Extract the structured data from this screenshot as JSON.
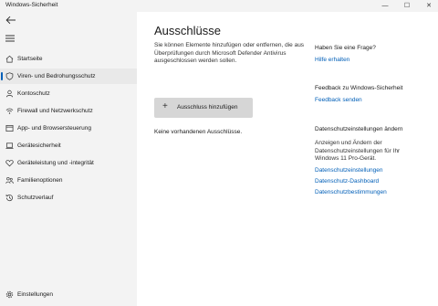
{
  "window": {
    "title": "Windows-Sicherheit",
    "minimize_glyph": "—",
    "maximize_glyph": "☐",
    "close_glyph": "✕"
  },
  "sidebar": {
    "items": [
      {
        "label": "Startseite",
        "icon": "home-icon"
      },
      {
        "label": "Viren- und Bedrohungsschutz",
        "icon": "shield-icon",
        "active": true
      },
      {
        "label": "Kontoschutz",
        "icon": "person-icon"
      },
      {
        "label": "Firewall und Netzwerkschutz",
        "icon": "wifi-icon"
      },
      {
        "label": "App- und Browsersteuerung",
        "icon": "app-window-icon"
      },
      {
        "label": "Gerätesicherheit",
        "icon": "laptop-icon"
      },
      {
        "label": "Geräteleistung und -integrität",
        "icon": "heart-icon"
      },
      {
        "label": "Familienoptionen",
        "icon": "family-icon"
      },
      {
        "label": "Schutzverlauf",
        "icon": "history-icon"
      }
    ],
    "settings_label": "Einstellungen"
  },
  "main": {
    "title": "Ausschlüsse",
    "description": "Sie können Elemente hinzufügen oder entfernen, die aus Überprüfungen durch Microsoft Defender Antivirus ausgeschlossen werden sollen.",
    "add_button_label": "Ausschluss hinzufügen",
    "empty_text": "Keine vorhandenen Ausschlüsse."
  },
  "right_panel": {
    "question_heading": "Haben Sie eine Frage?",
    "help_link": "Hilfe erhalten",
    "feedback_heading": "Feedback zu Windows-Sicherheit",
    "feedback_link": "Feedback senden",
    "privacy_heading": "Datenschutzeinstellungen ändern",
    "privacy_text": "Anzeigen und Ändern der Datenschutzeinstellungen für Ihr Windows 11 Pro-Gerät.",
    "privacy_links": [
      "Datenschutzeinstellungen",
      "Datenschutz-Dashboard",
      "Datenschutzbestimmungen"
    ]
  },
  "colors": {
    "accent": "#005fb8",
    "sidebar_bg": "#f3f3f3",
    "button_bg": "#d6d6d6"
  }
}
